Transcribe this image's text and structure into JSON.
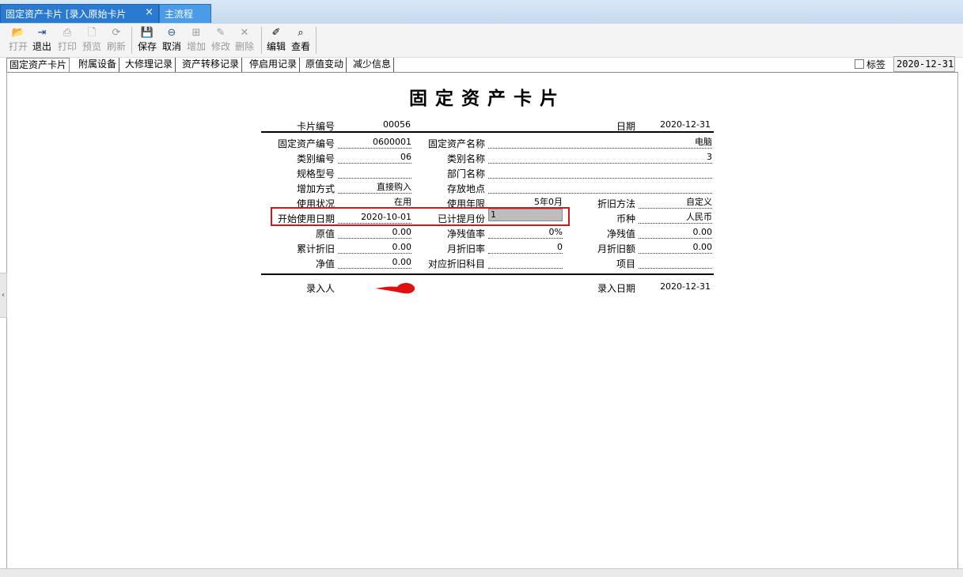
{
  "tabs": {
    "active_label": "固定资产卡片 [录入原始卡片",
    "close_symbol": "×",
    "main_label": "主流程"
  },
  "toolbar": {
    "open": "打开",
    "exit": "退出",
    "print": "打印",
    "preview": "预览",
    "refresh": "刷新",
    "save": "保存",
    "cancel": "取消",
    "add": "增加",
    "modify": "修改",
    "delete": "删除",
    "edit": "编辑",
    "view": "查看"
  },
  "subtabs": [
    "固定资产卡片",
    "附属设备",
    "大修理记录",
    "资产转移记录",
    "停启用记录",
    "原值变动",
    "减少信息"
  ],
  "tag_label": "标签",
  "top_date": "2020-12-31",
  "card": {
    "title": "固定资产卡片",
    "card_no_label": "卡片编号",
    "card_no": "00056",
    "date_label": "日期",
    "date": "2020-12-31",
    "asset_code_label": "固定资产编号",
    "asset_code": "0600001",
    "asset_name_label": "固定资产名称",
    "asset_name": "电脑",
    "category_code_label": "类别编号",
    "category_code": "06",
    "category_name_label": "类别名称",
    "category_name": "3",
    "spec_label": "规格型号",
    "spec": "",
    "dept_label": "部门名称",
    "dept": "",
    "add_method_label": "增加方式",
    "add_method": "直接购入",
    "location_label": "存放地点",
    "location": "",
    "status_label": "使用状况",
    "status": "在用",
    "life_label": "使用年限",
    "life": "5年0月",
    "dep_method_label": "折旧方法",
    "dep_method": "自定义",
    "start_date_label": "开始使用日期",
    "start_date": "2020-10-01",
    "months_label": "已计提月份",
    "months": "1",
    "currency_label": "币种",
    "currency": "人民币",
    "original_label": "原值",
    "original": "0.00",
    "net_salvage_rate_label": "净残值率",
    "net_salvage_rate": "0%",
    "net_salvage_label": "净残值",
    "net_salvage": "0.00",
    "acc_dep_label": "累计折旧",
    "acc_dep": "0.00",
    "monthly_rate_label": "月折旧率",
    "monthly_rate": "0",
    "monthly_amount_label": "月折旧额",
    "monthly_amount": "0.00",
    "net_value_label": "净值",
    "net_value": "0.00",
    "dep_account_label": "对应折旧科目",
    "dep_account": "",
    "project_label": "项目",
    "project": "",
    "entered_by_label": "录入人",
    "entry_date_label": "录入日期",
    "entry_date": "2020-12-31"
  },
  "colors": {
    "tab_active": "#2b7ad1",
    "highlight": "#d01818",
    "signature": "#e01010"
  }
}
